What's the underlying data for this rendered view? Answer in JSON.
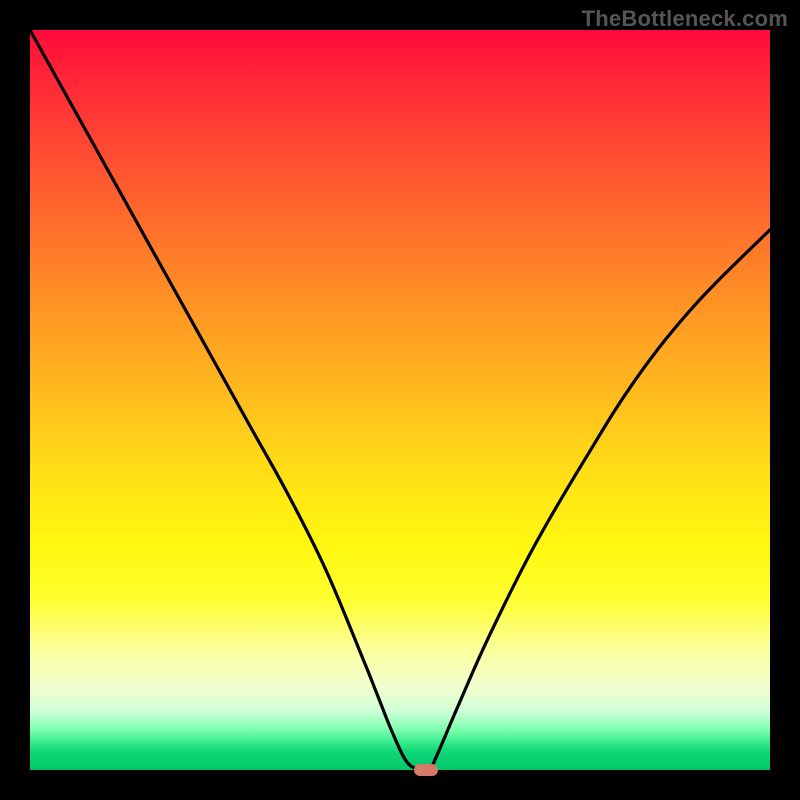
{
  "watermark": "TheBottleneck.com",
  "colors": {
    "curve_stroke": "#000000",
    "marker_fill": "#d87a6a",
    "frame": "#000000"
  },
  "chart_data": {
    "type": "line",
    "title": "",
    "xlabel": "",
    "ylabel": "",
    "xlim": [
      0,
      100
    ],
    "ylim": [
      0,
      100
    ],
    "gradient_meaning": "red = high bottleneck, green = low bottleneck",
    "series": [
      {
        "name": "bottleneck-curve",
        "x": [
          0,
          5,
          10,
          15,
          20,
          25,
          30,
          35,
          40,
          45,
          47,
          49,
          51,
          53,
          54,
          55,
          58,
          62,
          68,
          75,
          82,
          90,
          100
        ],
        "y": [
          100,
          91,
          82,
          73,
          64,
          55,
          46,
          37,
          27,
          15,
          10,
          5,
          1,
          0,
          0,
          2,
          9,
          18,
          30,
          42,
          53,
          63,
          73
        ]
      }
    ],
    "marker": {
      "x": 53.5,
      "y": 0
    }
  }
}
